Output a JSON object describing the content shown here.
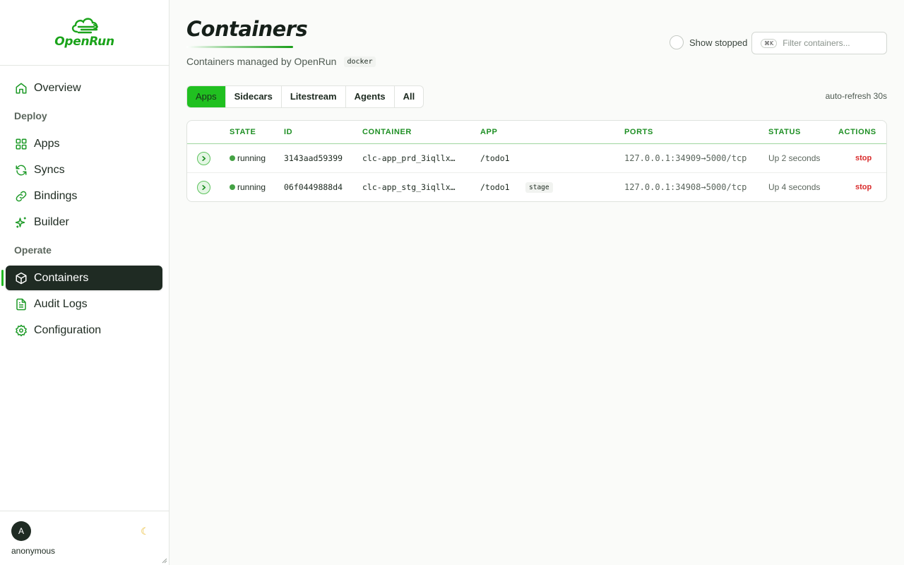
{
  "brand": {
    "name": "OpenRun",
    "color": "#1aa31a"
  },
  "sidebar": {
    "overview": "Overview",
    "section_deploy": "Deploy",
    "apps": "Apps",
    "syncs": "Syncs",
    "bindings": "Bindings",
    "builder": "Builder",
    "section_operate": "Operate",
    "containers": "Containers",
    "audit_logs": "Audit Logs",
    "configuration": "Configuration",
    "user_initial": "A",
    "username": "anonymous"
  },
  "header": {
    "title": "Containers",
    "subtitle": "Containers managed by OpenRun",
    "runtime_badge": "docker",
    "show_stopped": "Show stopped",
    "filter_shortcut": "⌘K",
    "filter_placeholder": "Filter containers...",
    "auto_refresh": "auto-refresh 30s"
  },
  "tabs": [
    "Apps",
    "Sidecars",
    "Litestream",
    "Agents",
    "All"
  ],
  "table": {
    "columns": [
      "STATE",
      "ID",
      "CONTAINER",
      "APP",
      "PORTS",
      "STATUS",
      "ACTIONS"
    ],
    "rows": [
      {
        "state": "running",
        "id": "3143aad59399",
        "container": "clc-app_prd_3iqllx…",
        "app": "/todo1",
        "badge": "",
        "ports": "127.0.0.1:34909→5000/tcp",
        "status": "Up 2 seconds",
        "action": "stop"
      },
      {
        "state": "running",
        "id": "06f0449888d4",
        "container": "clc-app_stg_3iqllx…",
        "app": "/todo1",
        "badge": "stage",
        "ports": "127.0.0.1:34908→5000/tcp",
        "status": "Up 4 seconds",
        "action": "stop"
      }
    ]
  },
  "colors": {
    "accent": "#20c020",
    "active_nav": "#1f2b23",
    "danger": "#d92b2b"
  }
}
